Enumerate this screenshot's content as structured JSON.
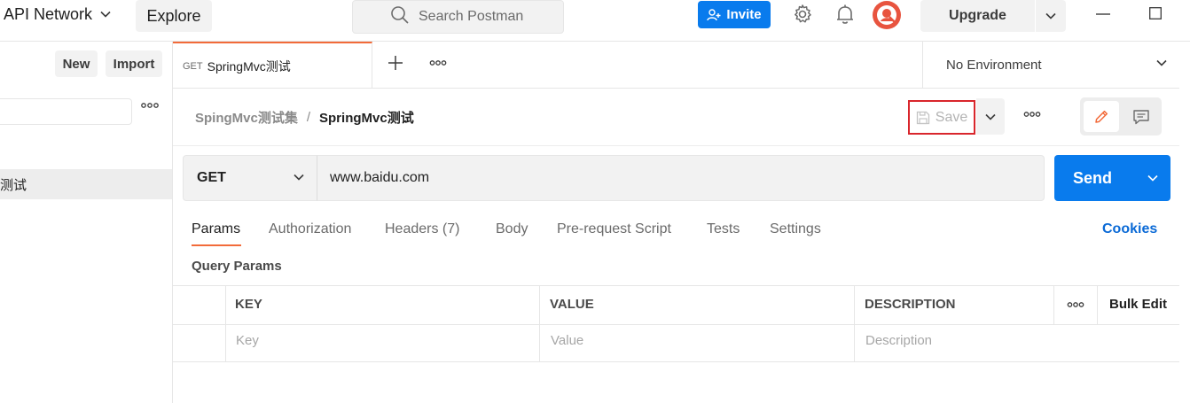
{
  "topbar": {
    "workspace_label": "API Network",
    "explore_label": "Explore",
    "search_placeholder": "Search Postman",
    "invite_label": "Invite",
    "upgrade_label": "Upgrade"
  },
  "sidebar": {
    "new_label": "New",
    "import_label": "Import",
    "selected_item_label": "测试"
  },
  "tabs": {
    "active": {
      "method": "GET",
      "name": "SpringMvc测试"
    },
    "environment_label": "No Environment"
  },
  "request": {
    "breadcrumb_parent": "SpingMvc测试集",
    "breadcrumb_separator": "/",
    "breadcrumb_current": "SpringMvc测试",
    "save_label": "Save",
    "method": "GET",
    "url": "www.baidu.com",
    "send_label": "Send"
  },
  "request_tabs": {
    "items": [
      "Params",
      "Authorization",
      "Headers (7)",
      "Body",
      "Pre-request Script",
      "Tests",
      "Settings"
    ],
    "cookies_label": "Cookies"
  },
  "params": {
    "title": "Query Params",
    "headers": {
      "key": "KEY",
      "value": "VALUE",
      "description": "DESCRIPTION",
      "bulk_edit": "Bulk Edit"
    },
    "placeholders": {
      "key": "Key",
      "value": "Value",
      "description": "Description"
    }
  },
  "colors": {
    "accent": "#f26b3a",
    "primary": "#097bed",
    "highlight_box": "#d9262c"
  }
}
